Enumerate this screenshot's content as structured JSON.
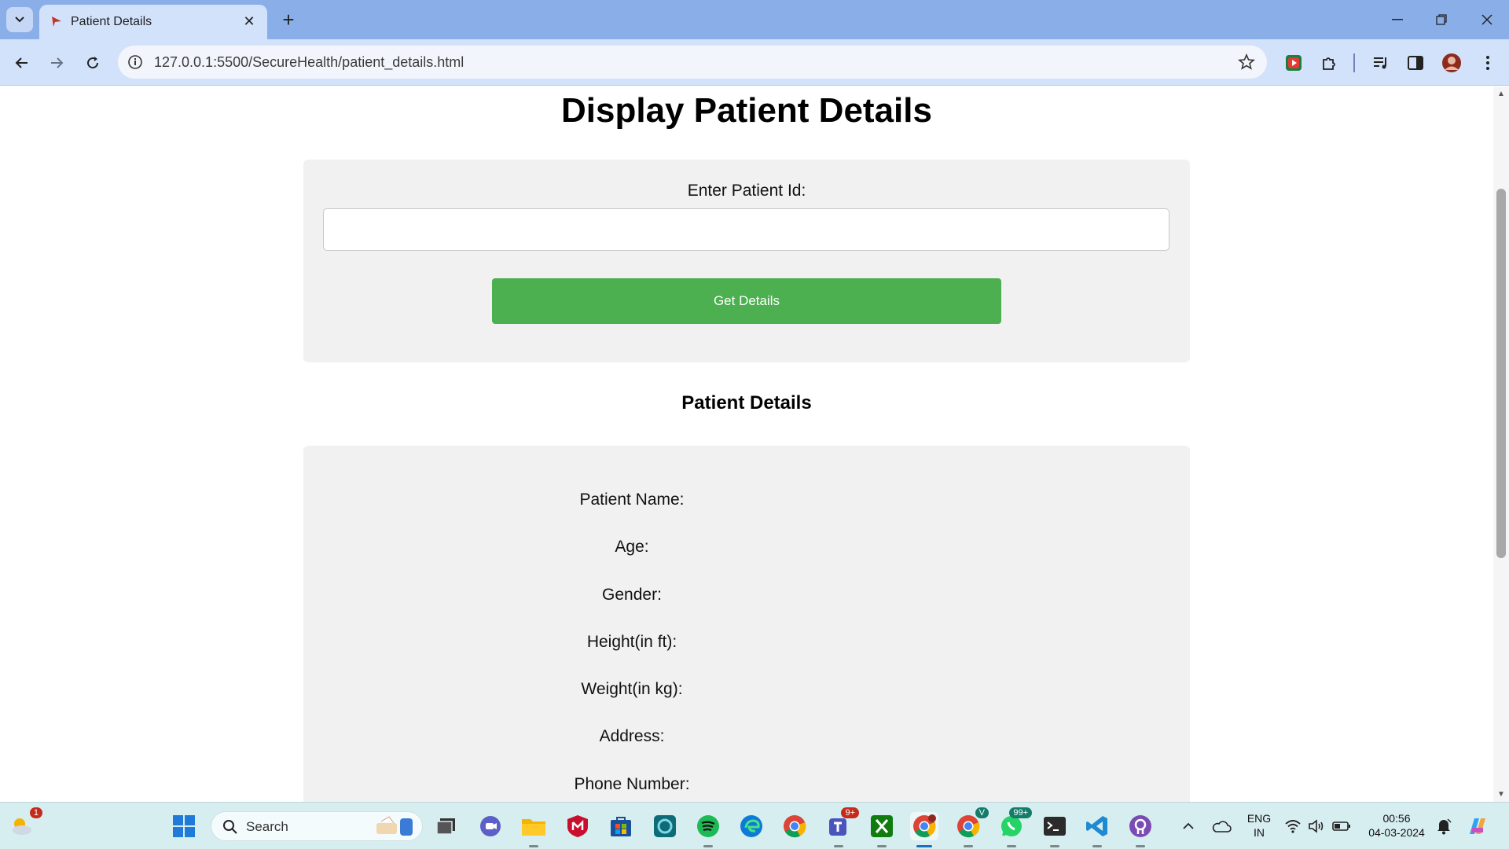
{
  "browser": {
    "tab_title": "Patient Details",
    "url": "127.0.0.1:5500/SecureHealth/patient_details.html"
  },
  "page": {
    "title": "Display Patient Details",
    "form": {
      "label": "Enter Patient Id:",
      "input_value": "",
      "button_label": "Get Details"
    },
    "details": {
      "heading": "Patient Details",
      "fields": [
        "Patient Name:",
        "Age:",
        "Gender:",
        "Height(in ft):",
        "Weight(in kg):",
        "Address:",
        "Phone Number:"
      ]
    }
  },
  "taskbar": {
    "weather_badge": "1",
    "search_placeholder": "Search",
    "teams_badge": "9+",
    "whatsapp_badge": "99+",
    "chrome_profile_badge": "V",
    "language": "ENG",
    "region": "IN",
    "time": "00:56",
    "date": "04-03-2024"
  },
  "colors": {
    "tabbar": "#8aaee8",
    "toolbar": "#d3e2fb",
    "button_green": "#4caf50",
    "card_bg": "#f1f1f1",
    "taskbar": "#d7eef0"
  }
}
